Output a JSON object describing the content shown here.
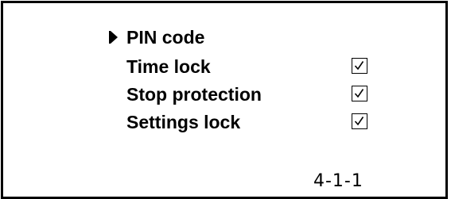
{
  "menu": {
    "items": [
      {
        "label": "PIN code",
        "selected": true,
        "has_checkbox": false
      },
      {
        "label": "Time lock",
        "selected": false,
        "has_checkbox": true,
        "checked": true
      },
      {
        "label": "Stop protection",
        "selected": false,
        "has_checkbox": true,
        "checked": true
      },
      {
        "label": "Settings lock",
        "selected": false,
        "has_checkbox": true,
        "checked": true
      }
    ]
  },
  "screen_code": "4-1-1"
}
